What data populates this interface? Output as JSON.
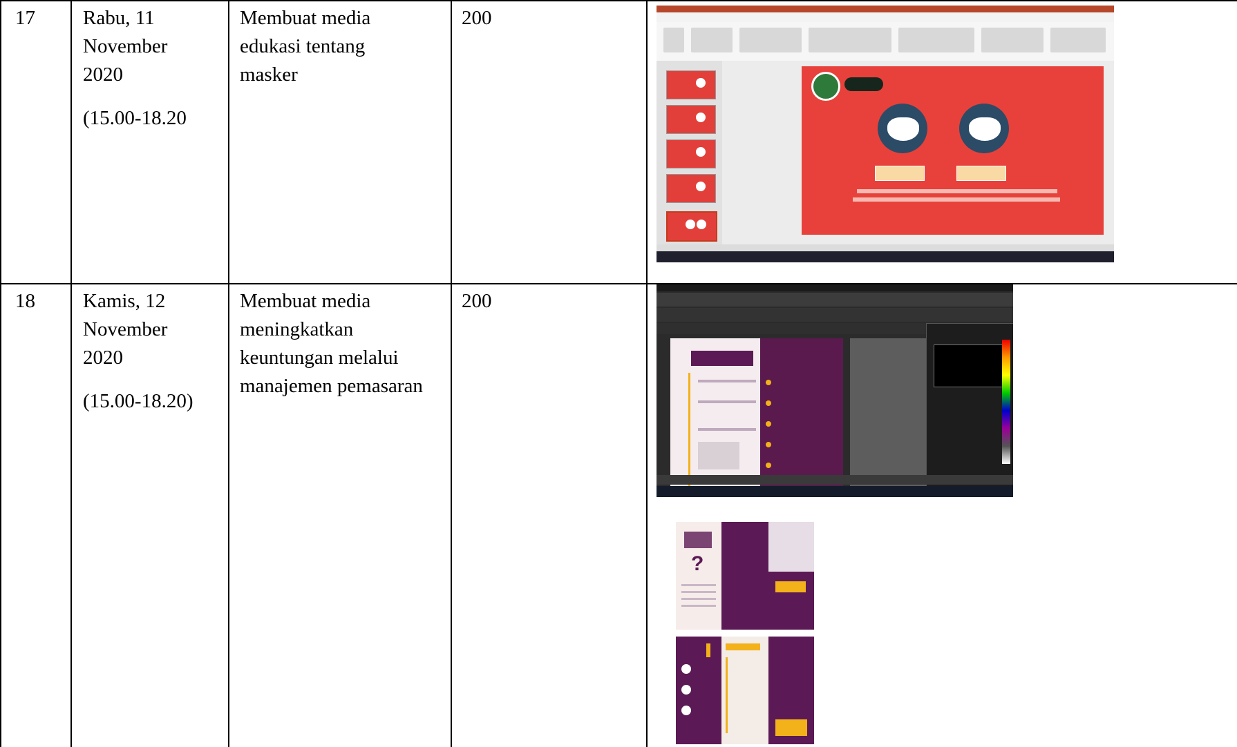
{
  "rows": [
    {
      "no": "17",
      "date_lines": [
        "Rabu, 11",
        "November",
        "2020"
      ],
      "time": "(15.00-18.20",
      "activity_lines": [
        "Membuat media",
        "edukasi  tentang",
        "masker"
      ],
      "amount": "200",
      "evidence": [
        "powerpoint-screenshot-icon"
      ]
    },
    {
      "no": "18",
      "date_lines": [
        "Kamis, 12",
        "November",
        "2020"
      ],
      "time": "(15.00-18.20)",
      "activity_lines": [
        "Membuat media",
        "meningkatkan",
        "keuntungan melalui",
        "manajemen pemasaran"
      ],
      "amount": "200",
      "evidence": [
        "coreldraw-screenshot-icon",
        "brochure-image-icon"
      ]
    }
  ],
  "colors": {
    "slide_red": "#e8413b",
    "brochure_purple": "#5b1a55",
    "brochure_yellow": "#f3b11a"
  }
}
